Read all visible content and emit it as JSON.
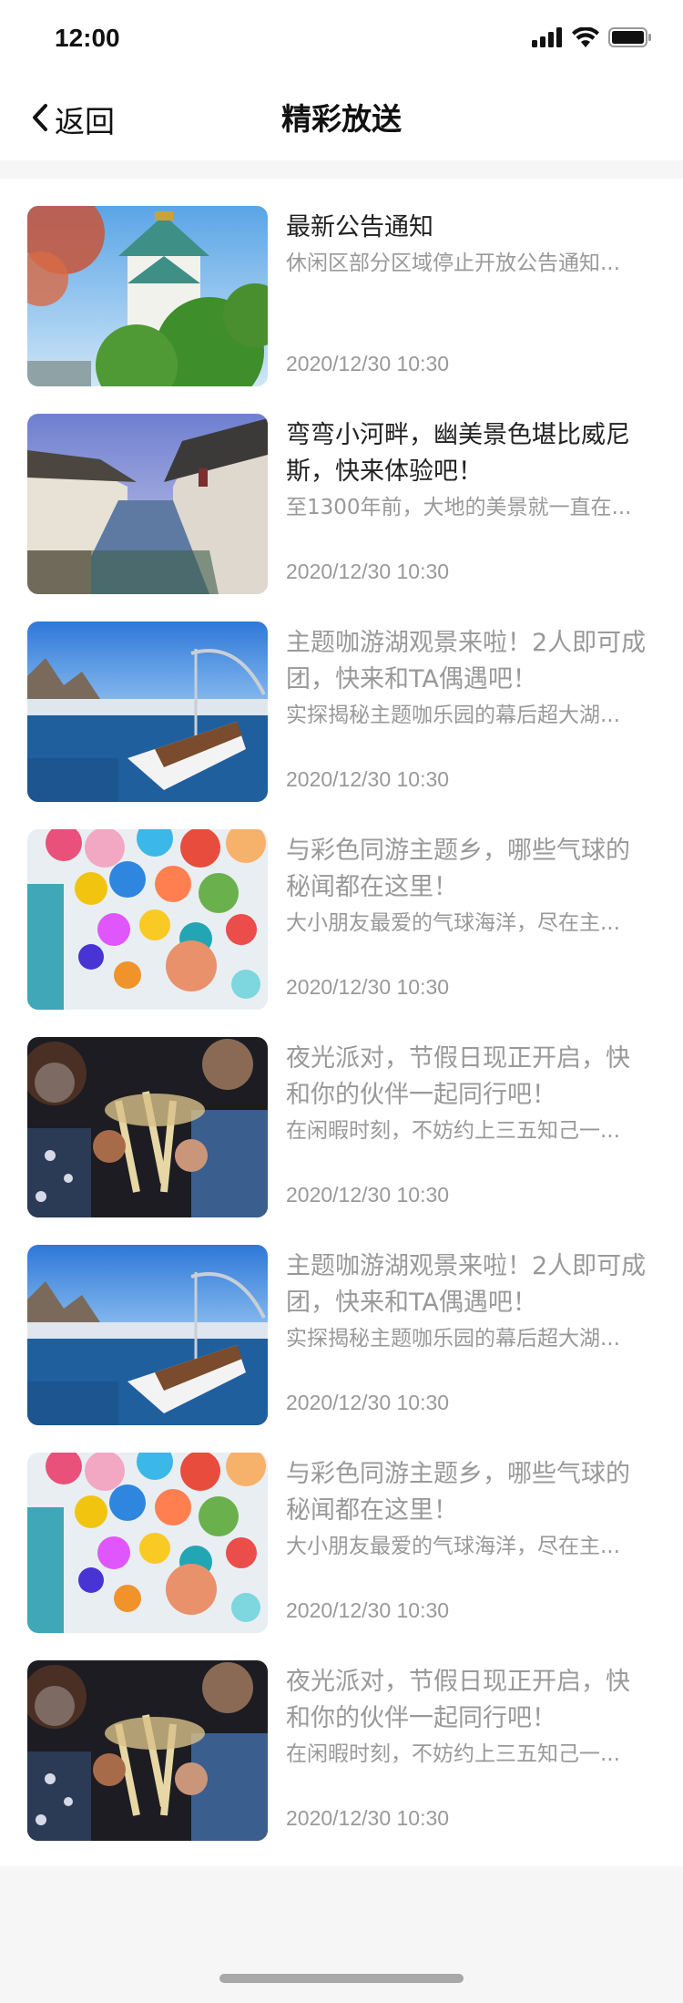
{
  "status_bar": {
    "time": "12:00",
    "icons": [
      "cellular-signal-icon",
      "wifi-icon",
      "battery-icon"
    ]
  },
  "nav": {
    "back_label": "返回",
    "title": "精彩放送"
  },
  "items": [
    {
      "title": "最新公告通知",
      "description": "休闲区部分区域停止开放公告通知...",
      "time": "2020/12/30 10:30",
      "image": "castle-photo"
    },
    {
      "title": "弯弯小河畔，幽美景色堪比威尼斯，快来体验吧！",
      "description": "至1300年前，大地的美景就一直在...",
      "time": "2020/12/30 10:30",
      "image": "canal-town-photo"
    },
    {
      "title": "主题咖游湖观景来啦！2人即可成团，快来和TA偶遇吧！",
      "description": "实探揭秘主题咖乐园的幕后超大湖...",
      "time": "2020/12/30 10:30",
      "image": "harbor-boat-photo"
    },
    {
      "title": "与彩色同游主题乡，哪些气球的秘闻都在这里！",
      "description": "大小朋友最爱的气球海洋，尽在主...",
      "time": "2020/12/30 10:30",
      "image": "balloons-photo"
    },
    {
      "title": "夜光派对，节假日现正开启，快和你的伙伴一起同行吧！",
      "description": "在闲暇时刻，不妨约上三五知己一...",
      "time": "2020/12/30 10:30",
      "image": "party-toast-photo"
    },
    {
      "title": "主题咖游湖观景来啦！2人即可成团，快来和TA偶遇吧！",
      "description": "实探揭秘主题咖乐园的幕后超大湖...",
      "time": "2020/12/30 10:30",
      "image": "harbor-boat-photo"
    },
    {
      "title": "与彩色同游主题乡，哪些气球的秘闻都在这里！",
      "description": "大小朋友最爱的气球海洋，尽在主...",
      "time": "2020/12/30 10:30",
      "image": "balloons-photo"
    },
    {
      "title": "夜光派对，节假日现正开启，快和你的伙伴一起同行吧！",
      "description": "在闲暇时刻，不妨约上三五知己一...",
      "time": "2020/12/30 10:30",
      "image": "party-toast-photo"
    }
  ]
}
